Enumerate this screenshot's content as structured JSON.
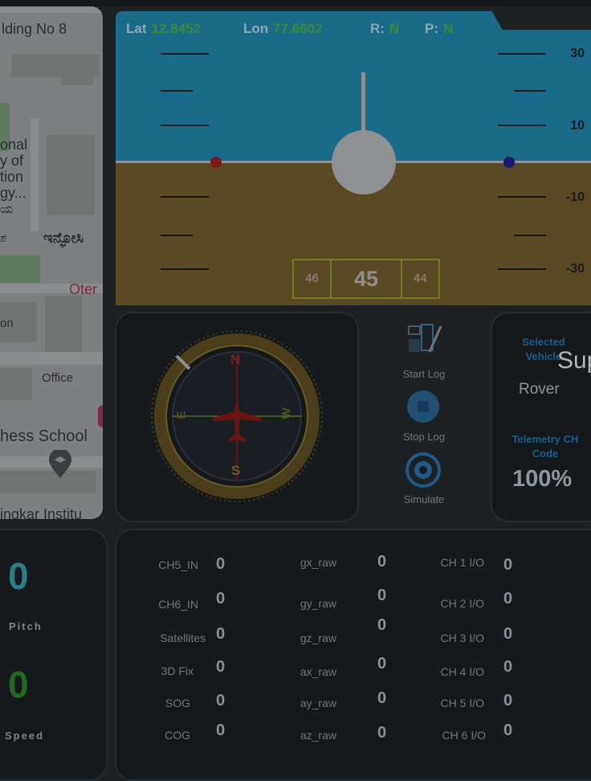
{
  "map": {
    "labels": [
      "lding No 8",
      "onal",
      "y of",
      "tion",
      "gy...",
      "ಯ",
      "ಶ",
      "ಇನ್ಫೋಸಿ",
      "Oter",
      "on",
      "Office",
      "hess School",
      "ingkar Institu"
    ]
  },
  "attitude": {
    "lat_label": "Lat",
    "lat_value": "12.8452",
    "lon_label": "Lon",
    "lon_value": "77.6602",
    "roll_label": "R:",
    "roll_value": "N",
    "pitch_label": "P:",
    "pitch_value": "N",
    "scale": [
      "30",
      "10",
      "-10",
      "-30"
    ],
    "heading": {
      "left": "46",
      "center": "45",
      "right": "44"
    }
  },
  "compass": {
    "n": "N",
    "s": "S",
    "e": "E",
    "w": "W"
  },
  "log_controls": {
    "start_log": "Start Log",
    "stop_log": "Stop Log",
    "simulate": "Simulate"
  },
  "vehicle": {
    "selected_label_1": "Selected",
    "selected_label_2": "Vehicle",
    "selected_value": "Rover",
    "telemetry_label_1": "Telemetry CH",
    "telemetry_label_2": "Code",
    "telemetry_value": "100%"
  },
  "overflow_text": "Sup",
  "left_panel": {
    "pitch_value": "0",
    "pitch_label": "Pitch",
    "speed_value": "0",
    "speed_label": "Speed"
  },
  "data": {
    "col1": [
      {
        "label": "CH5_IN",
        "value": "0"
      },
      {
        "label": "CH6_IN",
        "value": "0"
      },
      {
        "label": "Satellites",
        "value": "0"
      },
      {
        "label": "3D Fix",
        "value": "0"
      },
      {
        "label": "SOG",
        "value": "0"
      },
      {
        "label": "COG",
        "value": "0"
      }
    ],
    "col2": [
      {
        "label": "gx_raw",
        "value": "0"
      },
      {
        "label": "gy_raw",
        "value": "0"
      },
      {
        "label": "gz_raw",
        "value": "0"
      },
      {
        "label": "ax_raw",
        "value": "0"
      },
      {
        "label": "ay_raw",
        "value": "0"
      },
      {
        "label": "az_raw",
        "value": "0"
      }
    ],
    "col3": [
      {
        "label": "CH 1 I/O",
        "value": "0"
      },
      {
        "label": "CH 2 I/O",
        "value": "0"
      },
      {
        "label": "CH 3 I/O",
        "value": "0"
      },
      {
        "label": "CH 4 I/O",
        "value": "0"
      },
      {
        "label": "CH 5 I/O",
        "value": "0"
      },
      {
        "label": "CH 6 I/O",
        "value": "0"
      }
    ]
  },
  "colors": {
    "sky": "#1a6a8a",
    "ground": "#5a4a24",
    "accent_blue": "#1c5d8a",
    "pitch_value": "#2a7f86",
    "speed_value": "#1f6b23"
  }
}
